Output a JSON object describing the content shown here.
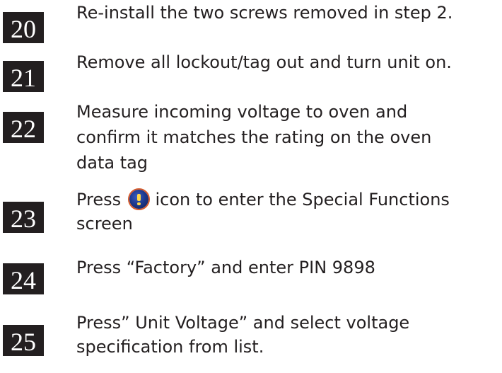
{
  "steps": [
    {
      "number": "20",
      "lines": [
        "Re-install the two screws removed in step 2."
      ]
    },
    {
      "number": "21",
      "lines": [
        "Remove all lockout/tag out and turn unit on."
      ]
    },
    {
      "number": "22",
      "lines": [
        "Measure incoming voltage to oven and",
        "confirm it matches the rating on the oven",
        "data tag"
      ]
    },
    {
      "number": "23",
      "line1_before_icon": "Press",
      "line1_after_icon": "icon to enter the Special Functions",
      "line2": "screen",
      "icon": "special-functions-icon"
    },
    {
      "number": "24",
      "lines": [
        "Press “Factory” and enter PIN 9898"
      ]
    },
    {
      "number": "25",
      "lines": [
        "Press” Unit Voltage” and select voltage",
        "specification from list."
      ]
    }
  ]
}
